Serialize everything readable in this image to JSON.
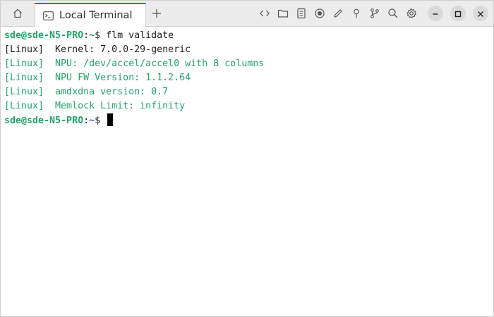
{
  "tabs": [
    {
      "label": "Local Terminal",
      "icon": "terminal-icon",
      "active": true
    }
  ],
  "toolbar": {
    "icons": [
      "code-icon",
      "folder-icon",
      "document-icon",
      "record-icon",
      "edit-icon",
      "pin-icon",
      "git-branch-icon",
      "search-icon",
      "gear-icon"
    ]
  },
  "window_controls": [
    "minimize-icon",
    "maximize-icon",
    "close-icon"
  ],
  "colors": {
    "accent": "#1a73e8",
    "prompt_user": "#26a269",
    "prompt_path": "#3465a4",
    "output_green": "#26a269"
  },
  "terminal": {
    "prompt_user": "sde@sde-N5-PRO",
    "prompt_colon": ":",
    "prompt_path": "~",
    "prompt_symbol": "$ ",
    "command": "flm validate",
    "output": [
      {
        "text": "[Linux]  Kernel: 7.0.0-29-generic",
        "color": "default"
      },
      {
        "text": "[Linux]  NPU: /dev/accel/accel0 with 8 columns",
        "color": "green"
      },
      {
        "text": "[Linux]  NPU FW Version: 1.1.2.64",
        "color": "green"
      },
      {
        "text": "[Linux]  amdxdna version: 0.7",
        "color": "green"
      },
      {
        "text": "[Linux]  Memlock Limit: infinity",
        "color": "green"
      }
    ]
  }
}
